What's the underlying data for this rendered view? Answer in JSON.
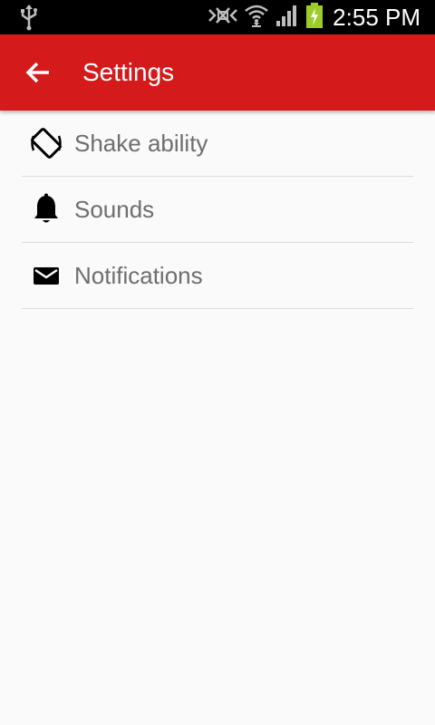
{
  "status_bar": {
    "time": "2:55 PM",
    "icons": [
      "usb-icon",
      "nfc-muted-icon",
      "wifi-icon",
      "signal-icon",
      "battery-charging-icon"
    ],
    "battery_color": "#9ccc2a"
  },
  "app_bar": {
    "title": "Settings",
    "back_icon": "arrow-back-icon",
    "color": "#d41a1a"
  },
  "settings": {
    "items": [
      {
        "label": "Shake ability",
        "icon": "screen-rotation-icon"
      },
      {
        "label": "Sounds",
        "icon": "bell-icon"
      },
      {
        "label": "Notifications",
        "icon": "envelope-icon"
      }
    ]
  }
}
